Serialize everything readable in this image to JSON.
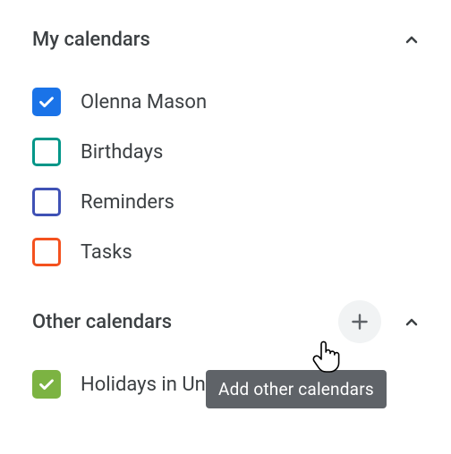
{
  "sections": {
    "my": {
      "title": "My calendars",
      "items": [
        {
          "label": "Olenna Mason",
          "color": "#1a73e8",
          "checked": true
        },
        {
          "label": "Birthdays",
          "color": "#009688",
          "checked": false
        },
        {
          "label": "Reminders",
          "color": "#3f51b5",
          "checked": false
        },
        {
          "label": "Tasks",
          "color": "#f4511e",
          "checked": false
        }
      ]
    },
    "other": {
      "title": "Other calendars",
      "items": [
        {
          "label": "Holidays in United States",
          "color": "#7cb342",
          "checked": true
        }
      ]
    }
  },
  "tooltip": "Add other calendars"
}
